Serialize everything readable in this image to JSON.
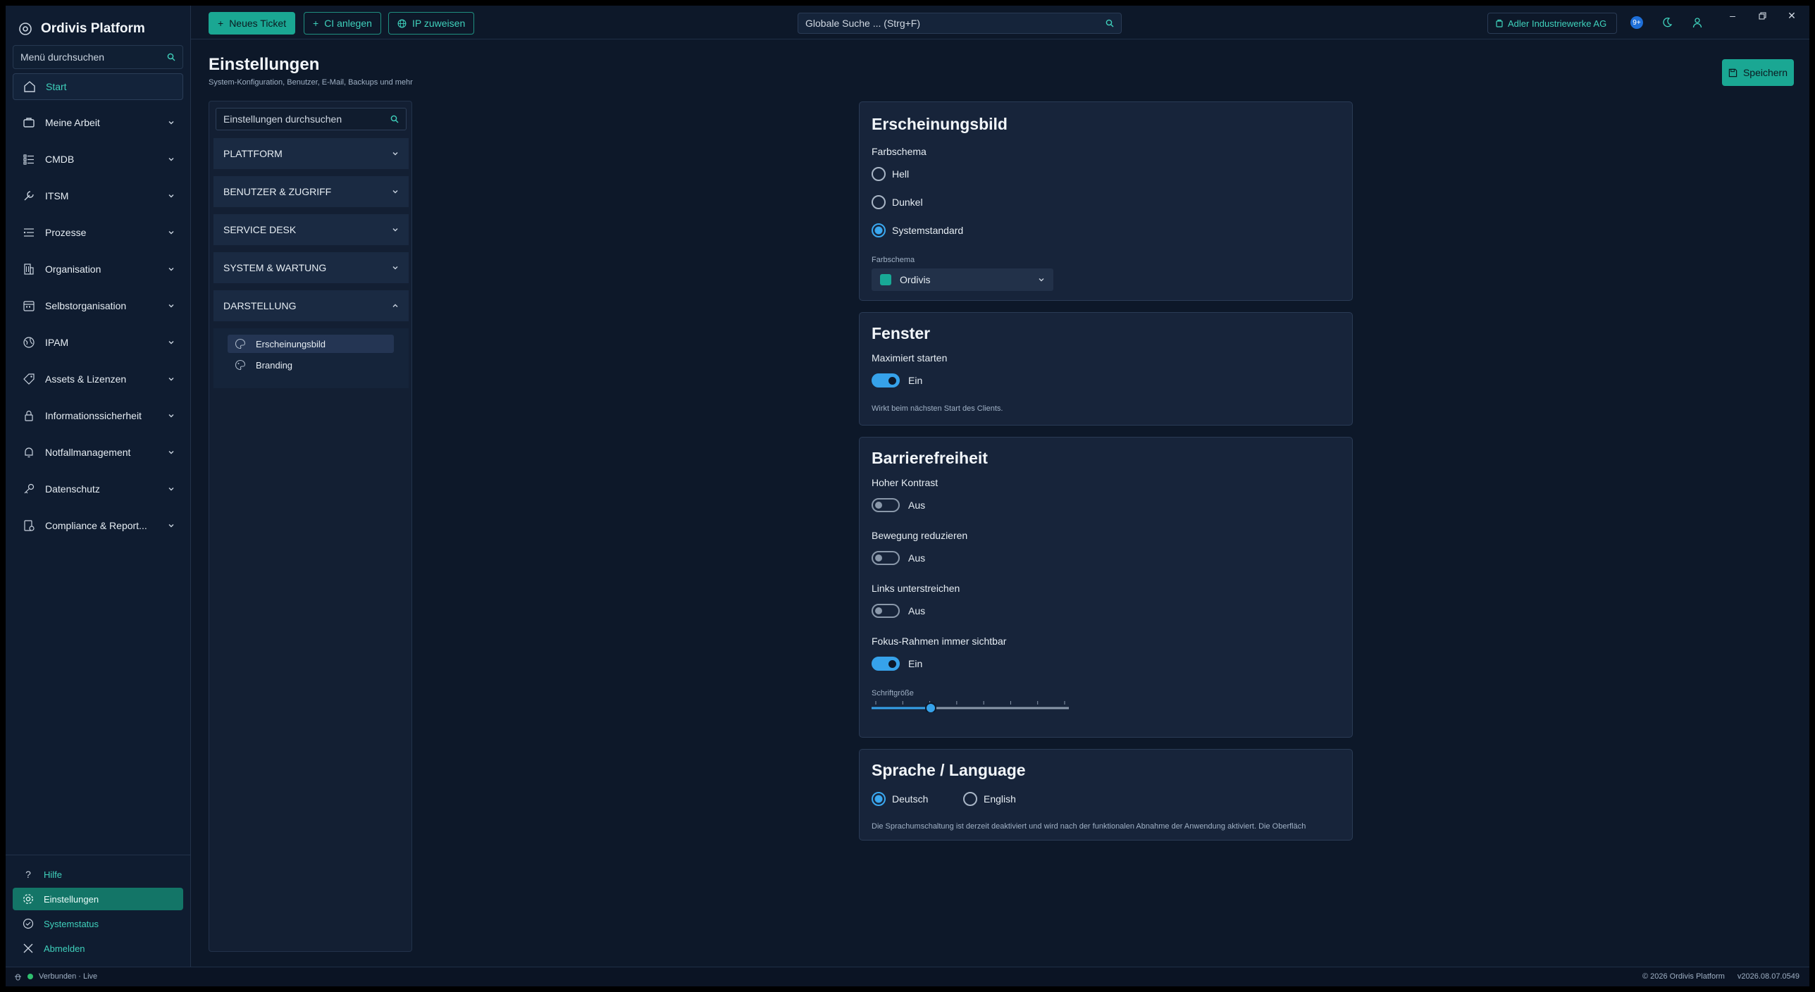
{
  "app": {
    "title": "Ordivis Platform"
  },
  "sidebar": {
    "search_placeholder": "Menü durchsuchen",
    "items": [
      {
        "label": "Start",
        "icon": "home-icon"
      },
      {
        "label": "Meine Arbeit",
        "icon": "briefcase-icon"
      },
      {
        "label": "CMDB",
        "icon": "list-icon"
      },
      {
        "label": "ITSM",
        "icon": "wrench-icon"
      },
      {
        "label": "Prozesse",
        "icon": "process-icon"
      },
      {
        "label": "Organisation",
        "icon": "building-icon"
      },
      {
        "label": "Selbstorganisation",
        "icon": "calendar-icon"
      },
      {
        "label": "IPAM",
        "icon": "globe-icon"
      },
      {
        "label": "Assets & Lizenzen",
        "icon": "tag-icon"
      },
      {
        "label": "Informationssicherheit",
        "icon": "lock-icon"
      },
      {
        "label": "Notfallmanagement",
        "icon": "bell-icon"
      },
      {
        "label": "Datenschutz",
        "icon": "key-icon"
      },
      {
        "label": "Compliance & Report...",
        "icon": "report-icon"
      }
    ],
    "footer": [
      {
        "label": "Hilfe",
        "icon": "help-icon"
      },
      {
        "label": "Einstellungen",
        "icon": "gear-icon"
      },
      {
        "label": "Systemstatus",
        "icon": "check-circle-icon"
      },
      {
        "label": "Abmelden",
        "icon": "close-icon"
      }
    ]
  },
  "topbar": {
    "new_ticket": "Neues Ticket",
    "ci_create": "CI anlegen",
    "ip_assign": "IP zuweisen",
    "global_search": "Globale Suche ... (Strg+F)",
    "organization": "Adler Industriewerke AG",
    "notification_badge": "9+"
  },
  "page": {
    "title": "Einstellungen",
    "subtitle": "System-Konfiguration, Benutzer, E-Mail, Backups und mehr",
    "save": "Speichern"
  },
  "settings_nav": {
    "search_placeholder": "Einstellungen durchsuchen",
    "sections": [
      "PLATTFORM",
      "BENUTZER & ZUGRIFF",
      "SERVICE DESK",
      "SYSTEM & WARTUNG",
      "DARSTELLUNG"
    ],
    "sub_items": [
      "Erscheinungsbild",
      "Branding"
    ]
  },
  "appearance": {
    "title": "Erscheinungsbild",
    "scheme_label": "Farbschema",
    "options": [
      "Hell",
      "Dunkel",
      "Systemstandard"
    ],
    "selected": "Systemstandard",
    "palette_label": "Farbschema",
    "palette_value": "Ordivis",
    "palette_color": "#18a996"
  },
  "window": {
    "title": "Fenster",
    "maximized_label": "Maximiert starten",
    "maximized_state": "Ein",
    "hint": "Wirkt beim nächsten Start des Clients."
  },
  "accessibility": {
    "title": "Barrierefreiheit",
    "high_contrast": {
      "label": "Hoher Kontrast",
      "state": "Aus"
    },
    "reduce_motion": {
      "label": "Bewegung reduzieren",
      "state": "Aus"
    },
    "underline_links": {
      "label": "Links unterstreichen",
      "state": "Aus"
    },
    "focus_ring": {
      "label": "Fokus-Rahmen immer sichtbar",
      "state": "Ein"
    },
    "font_size_label": "Schriftgröße",
    "font_size_level": 0.3
  },
  "language": {
    "title": "Sprache / Language",
    "options": [
      "Deutsch",
      "English"
    ],
    "selected": "Deutsch",
    "note": "Die Sprachumschaltung ist derzeit deaktiviert und wird nach der funktionalen Abnahme der Anwendung aktiviert. Die Oberfläch"
  },
  "status": {
    "connection": "Verbunden · Live",
    "copyright": "© 2026 Ordivis Platform",
    "version": "v2026.08.07.0549"
  },
  "colors": {
    "accent": "#1aa793",
    "toggle_on": "#36a2ea",
    "background": "#0d1829"
  }
}
